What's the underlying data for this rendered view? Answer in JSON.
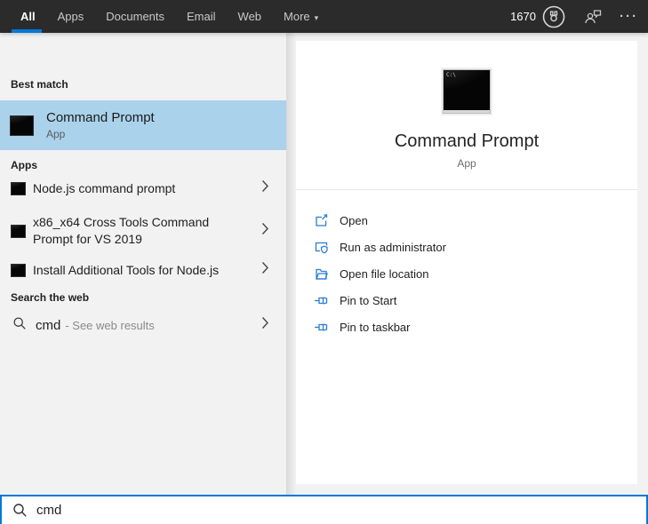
{
  "topbar": {
    "tabs": [
      {
        "label": "All",
        "active": true
      },
      {
        "label": "Apps",
        "active": false
      },
      {
        "label": "Documents",
        "active": false
      },
      {
        "label": "Email",
        "active": false
      },
      {
        "label": "Web",
        "active": false
      },
      {
        "label": "More",
        "active": false,
        "dropdown_arrow": "▾"
      }
    ],
    "rewards_points": "1670",
    "ellipsis": "···",
    "icons": [
      "rewards-medal-icon",
      "feedback-icon",
      "more-options-icon"
    ]
  },
  "left_panel": {
    "best_match": {
      "header": "Best match",
      "item": {
        "title": "Command Prompt",
        "subtitle": "App",
        "icon": "command-prompt-icon"
      }
    },
    "apps": {
      "header": "Apps",
      "items": [
        {
          "label": "Node.js command prompt",
          "icon": "terminal-icon"
        },
        {
          "label": "x86_x64 Cross Tools Command Prompt for VS 2019",
          "icon": "terminal-icon"
        },
        {
          "label": "Install Additional Tools for Node.js",
          "icon": "terminal-icon"
        }
      ]
    },
    "web": {
      "header": "Search the web",
      "item": {
        "query": "cmd",
        "suffix": "- See web results",
        "icon": "search-icon"
      }
    }
  },
  "preview_panel": {
    "app_title": "Command Prompt",
    "app_subtitle": "App",
    "app_icon_glyph": "C:\\",
    "actions": [
      {
        "label": "Open",
        "icon": "open-icon"
      },
      {
        "label": "Run as administrator",
        "icon": "run-as-admin-icon"
      },
      {
        "label": "Open file location",
        "icon": "file-location-icon"
      },
      {
        "label": "Pin to Start",
        "icon": "pin-icon"
      },
      {
        "label": "Pin to taskbar",
        "icon": "pin-icon"
      }
    ]
  },
  "search_bar": {
    "value": "cmd",
    "icon": "search-icon"
  },
  "colors": {
    "accent": "#0078d7",
    "best_match_highlight": "#aad2eb",
    "topbar_bg": "#2b2b2b",
    "panel_bg": "#f2f2f2",
    "action_icon_blue": "#2b7cd3"
  }
}
